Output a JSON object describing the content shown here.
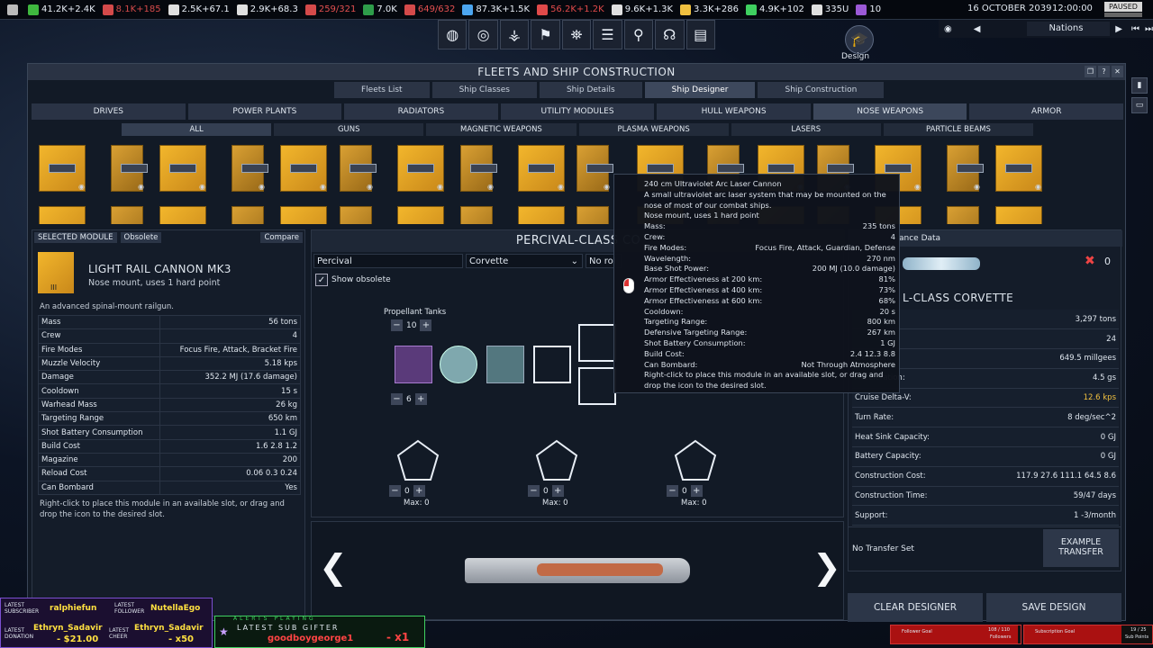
{
  "resources": [
    {
      "icon": "faction-icon",
      "value": "",
      "color": "#bbbbbb"
    },
    {
      "icon": "money-icon",
      "value": "41.2K+2.4K",
      "color": "#3fb83f"
    },
    {
      "icon": "influence-icon",
      "value": "8.1K+185",
      "color": "#d44a4a"
    },
    {
      "icon": "ops-icon",
      "value": "2.5K+67.1",
      "color": "#e0e0e0"
    },
    {
      "icon": "boost-icon",
      "value": "2.9K+68.3",
      "color": "#e0e0e0"
    },
    {
      "icon": "mission-control-icon",
      "value": "259/321",
      "color": "#d44a4a"
    },
    {
      "icon": "research-icon",
      "value": "7.0K",
      "color": "#2e9d4a"
    },
    {
      "icon": "control-points-icon",
      "value": "649/632",
      "color": "#d44a4a"
    },
    {
      "icon": "water-icon",
      "value": "87.3K+1.5K",
      "color": "#4ca6f0"
    },
    {
      "icon": "volatiles-icon",
      "value": "56.2K+1.2K",
      "color": "#e04a4a"
    },
    {
      "icon": "metals-icon",
      "value": "9.6K+1.3K",
      "color": "#e0e0e0"
    },
    {
      "icon": "nobles-icon",
      "value": "3.3K+286",
      "color": "#f0c040"
    },
    {
      "icon": "fissiles-icon",
      "value": "4.9K+102",
      "color": "#3fd060"
    },
    {
      "icon": "antimatter-icon",
      "value": "335U",
      "color": "#e0e0e0"
    },
    {
      "icon": "exotics-icon",
      "value": "10",
      "color": "#9b59d6"
    }
  ],
  "date": "16 OCTOBER 2039",
  "time": "12:00:00",
  "paused": "PAUSED",
  "nations_label": "Nations",
  "design_label": "Design",
  "nav_icons": [
    "globe-icon",
    "target-icon",
    "network-icon",
    "flag-icon",
    "council-icon",
    "sliders-icon",
    "tech-icon",
    "brain-icon",
    "ledger-icon"
  ],
  "window_title": "FLEETS AND SHIP CONSTRUCTION",
  "tabs": [
    "Fleets List",
    "Ship Classes",
    "Ship Details",
    "Ship Designer",
    "Ship Construction"
  ],
  "active_tab": "Ship Designer",
  "categories": [
    "DRIVES",
    "POWER PLANTS",
    "RADIATORS",
    "UTILITY MODULES",
    "HULL WEAPONS",
    "NOSE WEAPONS",
    "ARMOR"
  ],
  "subcategories": [
    "ALL",
    "GUNS",
    "MAGNETIC WEAPONS",
    "PLASMA WEAPONS",
    "LASERS",
    "PARTICLE BEAMS"
  ],
  "selected_module": {
    "header": "SELECTED MODULE",
    "obsolete": "Obsolete",
    "compare": "Compare",
    "tier": "III",
    "name": "LIGHT RAIL CANNON MK3",
    "subtitle": "Nose mount, uses 1 hard point",
    "description": "An advanced spinal-mount railgun.",
    "stats": [
      [
        "Mass",
        "56 tons"
      ],
      [
        "Crew",
        "4"
      ],
      [
        "Fire Modes",
        "Focus Fire, Attack, Bracket Fire"
      ],
      [
        "Muzzle Velocity",
        "5.18 kps"
      ],
      [
        "Damage",
        "352.2 MJ (17.6 damage)"
      ],
      [
        "Cooldown",
        "15 s"
      ],
      [
        "Warhead Mass",
        "26 kg"
      ],
      [
        "Targeting Range",
        "650 km"
      ],
      [
        "Shot Battery Consumption",
        "1.1 GJ"
      ],
      [
        "Build Cost",
        "1.6 2.8 1.2"
      ],
      [
        "Magazine",
        "200"
      ],
      [
        "Reload Cost",
        "0.06 0.3 0.24"
      ],
      [
        "Can Bombard",
        "Yes"
      ]
    ],
    "hint": "Right-click to place this module in an available slot, or drag and drop the icon to the desired slot."
  },
  "designer": {
    "class_title": "PERCIVAL-CLASS CO",
    "name_value": "Percival",
    "hull_value": "Corvette",
    "role_value": "No rol",
    "show_obsolete": "Show obsolete",
    "propellant_label": "Propellant Tanks",
    "propellant_count": "10",
    "second_count": "6",
    "hardpoints": [
      {
        "count": "0",
        "max": "Max: 0"
      },
      {
        "count": "0",
        "max": "Max: 0"
      },
      {
        "count": "0",
        "max": "Max: 0"
      }
    ]
  },
  "performance": {
    "header": "Performance Data",
    "header_visible": "ance Data",
    "weapons_count": "0",
    "title": "L-CLASS CORVETTE",
    "stats": [
      [
        "",
        "3,297 tons"
      ],
      [
        "",
        "24"
      ],
      [
        "eleration:",
        "649.5 millgees"
      ],
      [
        "Acceleration:",
        "4.5 gs"
      ],
      [
        "Cruise Delta-V:",
        "12.6 kps"
      ],
      [
        "Turn Rate:",
        "8 deg/sec^2"
      ],
      [
        "Heat Sink Capacity:",
        "0 GJ"
      ],
      [
        "Battery Capacity:",
        "0 GJ"
      ],
      [
        "Construction Cost:",
        "117.9 27.6 111.1 64.5 8.6"
      ],
      [
        "Construction Time:",
        "59/47 days"
      ],
      [
        "Support:",
        "1 -3/month"
      ]
    ]
  },
  "transfer": {
    "label": "No Transfer Set",
    "button": "EXAMPLE TRANSFER"
  },
  "buttons": {
    "clear": "CLEAR DESIGNER",
    "save": "SAVE DESIGN"
  },
  "tooltip": {
    "title": "240 cm Ultraviolet Arc Laser Cannon",
    "description": "A small ultraviolet arc laser system that may be mounted on the nose of most of our combat ships.",
    "mount": "Nose mount, uses 1 hard point",
    "rows": [
      [
        "Mass:",
        "235 tons"
      ],
      [
        "Crew:",
        "4"
      ],
      [
        "Fire Modes:",
        "Focus Fire, Attack, Guardian, Defense"
      ],
      [
        "Wavelength:",
        "270 nm"
      ],
      [
        "Base Shot Power:",
        "200 MJ (10.0 damage)"
      ],
      [
        "Armor Effectiveness at 200 km:",
        "81%"
      ],
      [
        "Armor Effectiveness at 400 km:",
        "73%"
      ],
      [
        "Armor Effectiveness at 600 km:",
        "68%"
      ],
      [
        "Cooldown:",
        "20 s"
      ],
      [
        "Targeting Range:",
        "800 km"
      ],
      [
        "Defensive Targeting Range:",
        "267 km"
      ],
      [
        "Shot Battery Consumption:",
        "1 GJ"
      ],
      [
        "Build Cost:",
        "2.4 12.3 8.8"
      ],
      [
        "Can Bombard:",
        "Not Through Atmosphere"
      ]
    ],
    "hint": "Right-click to place this module in an available slot, or drag and drop the icon to the desired slot."
  },
  "stream": {
    "latest_subscriber_label": "LATEST SUBSCRIBER",
    "latest_subscriber": "ralphiefun",
    "latest_follower_label": "LATEST FOLLOWER",
    "latest_follower": "NutellaEgo",
    "latest_donation_label": "LATEST DONATION",
    "latest_donation_name": "Ethryn_Sadavir",
    "latest_donation_amount": "- $21.00",
    "latest_cheer_label": "LATEST CHEER",
    "latest_cheer_name": "Ethryn_Sadavir",
    "latest_cheer_amount": "- x50",
    "alerts_label": "ALERTS PLAYING",
    "gifter_label": "LATEST SUB GIFTER",
    "gifter": "goodboygeorge1",
    "gifter_amount": "- x1",
    "follower_goal_label": "Follower Goal",
    "follower_goal_value": "108 / 110",
    "follower_goal_unit": "Followers",
    "follower_goal_fraction": 0.98,
    "sub_goal_label": "Subscription Goal",
    "sub_goal_value": "19 / 25",
    "sub_goal_unit": "Sub Points",
    "sub_goal_fraction": 0.76
  }
}
